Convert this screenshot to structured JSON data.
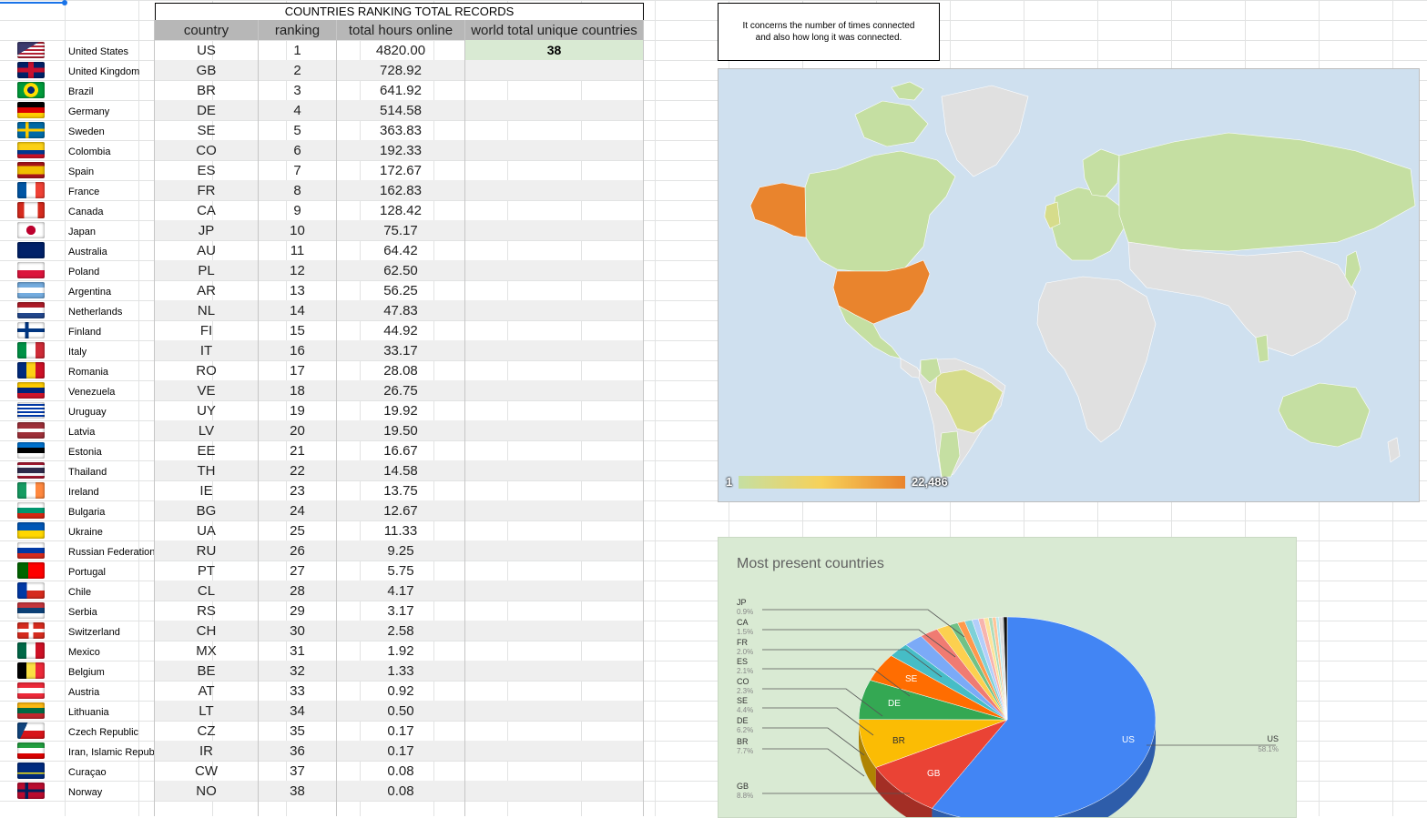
{
  "table": {
    "title": "COUNTRIES RANKING TOTAL RECORDS",
    "headers": {
      "country": "country",
      "ranking": "ranking",
      "hours": "total hours online",
      "world": "world total unique countries"
    },
    "unique_countries": "38",
    "rows": [
      {
        "name": "United States",
        "code": "US",
        "rank": "1",
        "hours": "4820.00",
        "flag": "us-flag-icon"
      },
      {
        "name": "United Kingdom",
        "code": "GB",
        "rank": "2",
        "hours": "728.92",
        "flag": "gb-flag-icon"
      },
      {
        "name": "Brazil",
        "code": "BR",
        "rank": "3",
        "hours": "641.92",
        "flag": "br-flag-icon"
      },
      {
        "name": "Germany",
        "code": "DE",
        "rank": "4",
        "hours": "514.58",
        "flag": "de-flag-icon"
      },
      {
        "name": "Sweden",
        "code": "SE",
        "rank": "5",
        "hours": "363.83",
        "flag": "se-flag-icon"
      },
      {
        "name": "Colombia",
        "code": "CO",
        "rank": "6",
        "hours": "192.33",
        "flag": "co-flag-icon"
      },
      {
        "name": "Spain",
        "code": "ES",
        "rank": "7",
        "hours": "172.67",
        "flag": "es-flag-icon"
      },
      {
        "name": "France",
        "code": "FR",
        "rank": "8",
        "hours": "162.83",
        "flag": "fr-flag-icon"
      },
      {
        "name": "Canada",
        "code": "CA",
        "rank": "9",
        "hours": "128.42",
        "flag": "ca-flag-icon"
      },
      {
        "name": "Japan",
        "code": "JP",
        "rank": "10",
        "hours": "75.17",
        "flag": "jp-flag-icon"
      },
      {
        "name": "Australia",
        "code": "AU",
        "rank": "11",
        "hours": "64.42",
        "flag": "au-flag-icon"
      },
      {
        "name": "Poland",
        "code": "PL",
        "rank": "12",
        "hours": "62.50",
        "flag": "pl-flag-icon"
      },
      {
        "name": "Argentina",
        "code": "AR",
        "rank": "13",
        "hours": "56.25",
        "flag": "ar-flag-icon"
      },
      {
        "name": "Netherlands",
        "code": "NL",
        "rank": "14",
        "hours": "47.83",
        "flag": "nl-flag-icon"
      },
      {
        "name": "Finland",
        "code": "FI",
        "rank": "15",
        "hours": "44.92",
        "flag": "fi-flag-icon"
      },
      {
        "name": "Italy",
        "code": "IT",
        "rank": "16",
        "hours": "33.17",
        "flag": "it-flag-icon"
      },
      {
        "name": "Romania",
        "code": "RO",
        "rank": "17",
        "hours": "28.08",
        "flag": "ro-flag-icon"
      },
      {
        "name": "Venezuela",
        "code": "VE",
        "rank": "18",
        "hours": "26.75",
        "flag": "ve-flag-icon"
      },
      {
        "name": "Uruguay",
        "code": "UY",
        "rank": "19",
        "hours": "19.92",
        "flag": "uy-flag-icon"
      },
      {
        "name": "Latvia",
        "code": "LV",
        "rank": "20",
        "hours": "19.50",
        "flag": "lv-flag-icon"
      },
      {
        "name": "Estonia",
        "code": "EE",
        "rank": "21",
        "hours": "16.67",
        "flag": "ee-flag-icon"
      },
      {
        "name": "Thailand",
        "code": "TH",
        "rank": "22",
        "hours": "14.58",
        "flag": "th-flag-icon"
      },
      {
        "name": "Ireland",
        "code": "IE",
        "rank": "23",
        "hours": "13.75",
        "flag": "ie-flag-icon"
      },
      {
        "name": "Bulgaria",
        "code": "BG",
        "rank": "24",
        "hours": "12.67",
        "flag": "bg-flag-icon"
      },
      {
        "name": "Ukraine",
        "code": "UA",
        "rank": "25",
        "hours": "11.33",
        "flag": "ua-flag-icon"
      },
      {
        "name": "Russian Federation",
        "code": "RU",
        "rank": "26",
        "hours": "9.25",
        "flag": "ru-flag-icon"
      },
      {
        "name": "Portugal",
        "code": "PT",
        "rank": "27",
        "hours": "5.75",
        "flag": "pt-flag-icon"
      },
      {
        "name": "Chile",
        "code": "CL",
        "rank": "28",
        "hours": "4.17",
        "flag": "cl-flag-icon"
      },
      {
        "name": "Serbia",
        "code": "RS",
        "rank": "29",
        "hours": "3.17",
        "flag": "rs-flag-icon"
      },
      {
        "name": "Switzerland",
        "code": "CH",
        "rank": "30",
        "hours": "2.58",
        "flag": "ch-flag-icon"
      },
      {
        "name": "Mexico",
        "code": "MX",
        "rank": "31",
        "hours": "1.92",
        "flag": "mx-flag-icon"
      },
      {
        "name": "Belgium",
        "code": "BE",
        "rank": "32",
        "hours": "1.33",
        "flag": "be-flag-icon"
      },
      {
        "name": "Austria",
        "code": "AT",
        "rank": "33",
        "hours": "0.92",
        "flag": "at-flag-icon"
      },
      {
        "name": "Lithuania",
        "code": "LT",
        "rank": "34",
        "hours": "0.50",
        "flag": "lt-flag-icon"
      },
      {
        "name": "Czech Republic",
        "code": "CZ",
        "rank": "35",
        "hours": "0.17",
        "flag": "cz-flag-icon"
      },
      {
        "name": "Iran, Islamic Republic",
        "code": "IR",
        "rank": "36",
        "hours": "0.17",
        "flag": "ir-flag-icon"
      },
      {
        "name": "Curaçao",
        "code": "CW",
        "rank": "37",
        "hours": "0.08",
        "flag": "cw-flag-icon"
      },
      {
        "name": "Norway",
        "code": "NO",
        "rank": "38",
        "hours": "0.08",
        "flag": "no-flag-icon"
      }
    ]
  },
  "note": {
    "line1": "It concerns the number of times connected",
    "line2": "and also how long it was connected."
  },
  "map": {
    "legend_min": "1",
    "legend_max": "22,486",
    "colors": {
      "ocean": "#cfe0ef",
      "nodata": "#e0e0e0",
      "low": "#c5dfa2",
      "mid": "#f7d159",
      "high": "#e9842d"
    }
  },
  "chart_data": {
    "type": "pie",
    "title": "Most present countries",
    "slices": [
      {
        "label": "US",
        "pct": "58.1%",
        "value": 58.1,
        "color": "#4285f4"
      },
      {
        "label": "GB",
        "pct": "8.8%",
        "value": 8.8,
        "color": "#ea4335"
      },
      {
        "label": "BR",
        "pct": "7.7%",
        "value": 7.7,
        "color": "#fbbc04"
      },
      {
        "label": "DE",
        "pct": "6.2%",
        "value": 6.2,
        "color": "#34a853"
      },
      {
        "label": "SE",
        "pct": "4.4%",
        "value": 4.4,
        "color": "#ff6d01"
      },
      {
        "label": "CO",
        "pct": "2.3%",
        "value": 2.3,
        "color": "#46bdc6"
      },
      {
        "label": "ES",
        "pct": "2.1%",
        "value": 2.1,
        "color": "#7baaf7"
      },
      {
        "label": "FR",
        "pct": "2.0%",
        "value": 2.0,
        "color": "#f07b72"
      },
      {
        "label": "CA",
        "pct": "1.5%",
        "value": 1.5,
        "color": "#fcd04f"
      },
      {
        "label": "JP",
        "pct": "0.9%",
        "value": 0.9,
        "color": "#71c287"
      }
    ],
    "other_slices": [
      0.8,
      0.8,
      0.7,
      0.6,
      0.5,
      0.4,
      0.4,
      0.3,
      0.3,
      0.2,
      0.4
    ],
    "other_colors": [
      "#ff994d",
      "#7ed1d7",
      "#b3cefb",
      "#f7b4ae",
      "#fde49b",
      "#aedcba",
      "#ffc599",
      "#b5e8ec",
      "#d9d9d9",
      "#bdbdbd",
      "#111111"
    ]
  }
}
